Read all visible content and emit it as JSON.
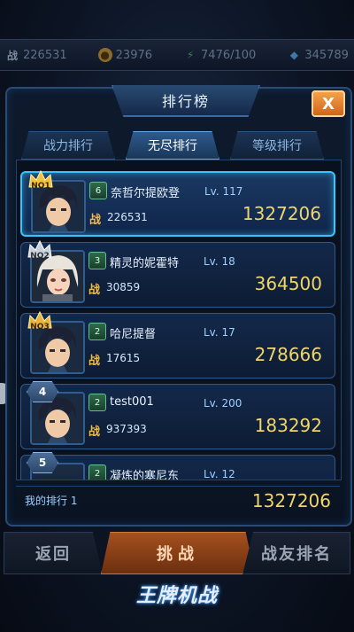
{
  "resources": {
    "combat_label": "战",
    "combat_value": "226531",
    "gold_value": "23976",
    "energy_value": "7476/100",
    "gems_value": "345789"
  },
  "panel": {
    "title": "排行榜",
    "close_label": "X",
    "tabs": [
      {
        "label": "战力排行",
        "active": false
      },
      {
        "label": "无尽排行",
        "active": true
      },
      {
        "label": "等级排行",
        "active": false
      }
    ]
  },
  "rankings": [
    {
      "rank": "NO1",
      "medal": "gold",
      "vip": "6",
      "name": "奈哲尔提欧登",
      "lv_label": "Lv.",
      "level": "117",
      "zhan": "战",
      "power": "226531",
      "score": "1327206",
      "selected": true
    },
    {
      "rank": "NO2",
      "medal": "silver",
      "vip": "3",
      "name": "精灵的妮霍特",
      "lv_label": "Lv.",
      "level": "18",
      "zhan": "战",
      "power": "30859",
      "score": "364500",
      "selected": false
    },
    {
      "rank": "NO3",
      "medal": "gold",
      "vip": "2",
      "name": "哈尼提督",
      "lv_label": "Lv.",
      "level": "17",
      "zhan": "战",
      "power": "17615",
      "score": "278666",
      "selected": false
    },
    {
      "rank": "4",
      "medal": "number",
      "vip": "2",
      "name": "test001",
      "lv_label": "Lv.",
      "level": "200",
      "zhan": "战",
      "power": "937393",
      "score": "183292",
      "selected": false
    },
    {
      "rank": "5",
      "medal": "number",
      "vip": "2",
      "name": "凝炼的塞尼东",
      "lv_label": "Lv.",
      "level": "12",
      "zhan": "",
      "power": "",
      "score": "",
      "selected": false
    }
  ],
  "my_rank": {
    "label": "我的排行 1",
    "score": "1327206"
  },
  "bottom": {
    "back_label": "返回",
    "challenge_label": "挑战",
    "friends_label": "战友排名",
    "logo_text": "王牌机战"
  },
  "colors": {
    "accent_cyan": "#36c6ff",
    "score_gold": "#f0d56a",
    "close_orange": "#e07a2a"
  }
}
